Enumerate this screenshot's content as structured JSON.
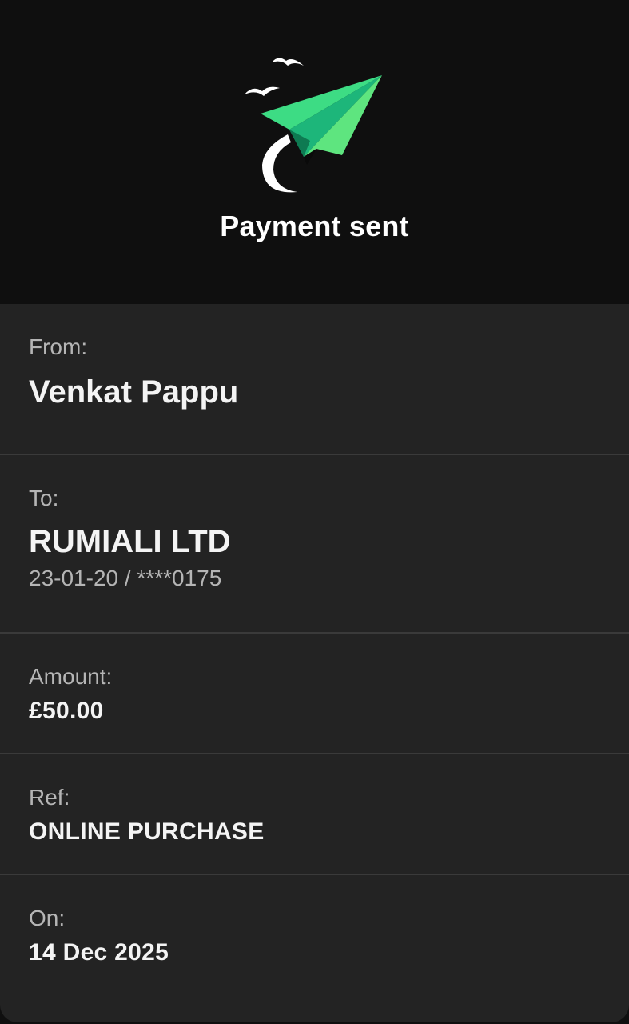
{
  "header": {
    "title": "Payment sent",
    "icon": "paper-plane-icon",
    "accent_color": "#3ddc84"
  },
  "details": {
    "from": {
      "label": "From:",
      "value": "Venkat Pappu"
    },
    "to": {
      "label": "To:",
      "value": "RUMIALI LTD",
      "account": "23-01-20 / ****0175"
    },
    "amount": {
      "label": "Amount:",
      "value": "£50.00"
    },
    "ref": {
      "label": "Ref:",
      "value": "ONLINE PURCHASE"
    },
    "on": {
      "label": "On:",
      "value": "14 Dec 2025"
    }
  }
}
